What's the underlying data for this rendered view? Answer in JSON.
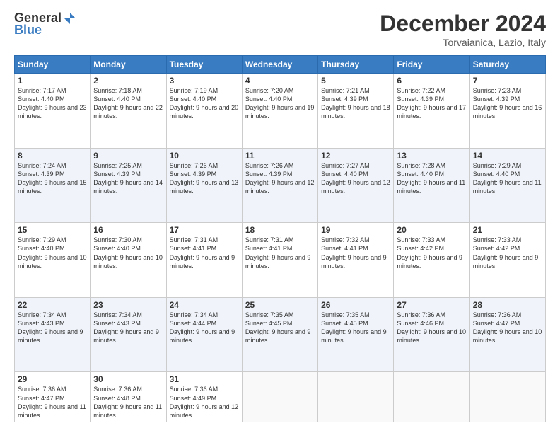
{
  "logo": {
    "general": "General",
    "blue": "Blue"
  },
  "header": {
    "month": "December 2024",
    "location": "Torvaianica, Lazio, Italy"
  },
  "weekdays": [
    "Sunday",
    "Monday",
    "Tuesday",
    "Wednesday",
    "Thursday",
    "Friday",
    "Saturday"
  ],
  "weeks": [
    [
      {
        "day": "1",
        "sunrise": "7:17 AM",
        "sunset": "4:40 PM",
        "daylight": "9 hours and 23 minutes."
      },
      {
        "day": "2",
        "sunrise": "7:18 AM",
        "sunset": "4:40 PM",
        "daylight": "9 hours and 22 minutes."
      },
      {
        "day": "3",
        "sunrise": "7:19 AM",
        "sunset": "4:40 PM",
        "daylight": "9 hours and 20 minutes."
      },
      {
        "day": "4",
        "sunrise": "7:20 AM",
        "sunset": "4:40 PM",
        "daylight": "9 hours and 19 minutes."
      },
      {
        "day": "5",
        "sunrise": "7:21 AM",
        "sunset": "4:39 PM",
        "daylight": "9 hours and 18 minutes."
      },
      {
        "day": "6",
        "sunrise": "7:22 AM",
        "sunset": "4:39 PM",
        "daylight": "9 hours and 17 minutes."
      },
      {
        "day": "7",
        "sunrise": "7:23 AM",
        "sunset": "4:39 PM",
        "daylight": "9 hours and 16 minutes."
      }
    ],
    [
      {
        "day": "8",
        "sunrise": "7:24 AM",
        "sunset": "4:39 PM",
        "daylight": "9 hours and 15 minutes."
      },
      {
        "day": "9",
        "sunrise": "7:25 AM",
        "sunset": "4:39 PM",
        "daylight": "9 hours and 14 minutes."
      },
      {
        "day": "10",
        "sunrise": "7:26 AM",
        "sunset": "4:39 PM",
        "daylight": "9 hours and 13 minutes."
      },
      {
        "day": "11",
        "sunrise": "7:26 AM",
        "sunset": "4:39 PM",
        "daylight": "9 hours and 12 minutes."
      },
      {
        "day": "12",
        "sunrise": "7:27 AM",
        "sunset": "4:40 PM",
        "daylight": "9 hours and 12 minutes."
      },
      {
        "day": "13",
        "sunrise": "7:28 AM",
        "sunset": "4:40 PM",
        "daylight": "9 hours and 11 minutes."
      },
      {
        "day": "14",
        "sunrise": "7:29 AM",
        "sunset": "4:40 PM",
        "daylight": "9 hours and 11 minutes."
      }
    ],
    [
      {
        "day": "15",
        "sunrise": "7:29 AM",
        "sunset": "4:40 PM",
        "daylight": "9 hours and 10 minutes."
      },
      {
        "day": "16",
        "sunrise": "7:30 AM",
        "sunset": "4:40 PM",
        "daylight": "9 hours and 10 minutes."
      },
      {
        "day": "17",
        "sunrise": "7:31 AM",
        "sunset": "4:41 PM",
        "daylight": "9 hours and 9 minutes."
      },
      {
        "day": "18",
        "sunrise": "7:31 AM",
        "sunset": "4:41 PM",
        "daylight": "9 hours and 9 minutes."
      },
      {
        "day": "19",
        "sunrise": "7:32 AM",
        "sunset": "4:41 PM",
        "daylight": "9 hours and 9 minutes."
      },
      {
        "day": "20",
        "sunrise": "7:33 AM",
        "sunset": "4:42 PM",
        "daylight": "9 hours and 9 minutes."
      },
      {
        "day": "21",
        "sunrise": "7:33 AM",
        "sunset": "4:42 PM",
        "daylight": "9 hours and 9 minutes."
      }
    ],
    [
      {
        "day": "22",
        "sunrise": "7:34 AM",
        "sunset": "4:43 PM",
        "daylight": "9 hours and 9 minutes."
      },
      {
        "day": "23",
        "sunrise": "7:34 AM",
        "sunset": "4:43 PM",
        "daylight": "9 hours and 9 minutes."
      },
      {
        "day": "24",
        "sunrise": "7:34 AM",
        "sunset": "4:44 PM",
        "daylight": "9 hours and 9 minutes."
      },
      {
        "day": "25",
        "sunrise": "7:35 AM",
        "sunset": "4:45 PM",
        "daylight": "9 hours and 9 minutes."
      },
      {
        "day": "26",
        "sunrise": "7:35 AM",
        "sunset": "4:45 PM",
        "daylight": "9 hours and 9 minutes."
      },
      {
        "day": "27",
        "sunrise": "7:36 AM",
        "sunset": "4:46 PM",
        "daylight": "9 hours and 10 minutes."
      },
      {
        "day": "28",
        "sunrise": "7:36 AM",
        "sunset": "4:47 PM",
        "daylight": "9 hours and 10 minutes."
      }
    ],
    [
      {
        "day": "29",
        "sunrise": "7:36 AM",
        "sunset": "4:47 PM",
        "daylight": "9 hours and 11 minutes."
      },
      {
        "day": "30",
        "sunrise": "7:36 AM",
        "sunset": "4:48 PM",
        "daylight": "9 hours and 11 minutes."
      },
      {
        "day": "31",
        "sunrise": "7:36 AM",
        "sunset": "4:49 PM",
        "daylight": "9 hours and 12 minutes."
      },
      null,
      null,
      null,
      null
    ]
  ],
  "labels": {
    "sunrise": "Sunrise:",
    "sunset": "Sunset:",
    "daylight": "Daylight:"
  }
}
